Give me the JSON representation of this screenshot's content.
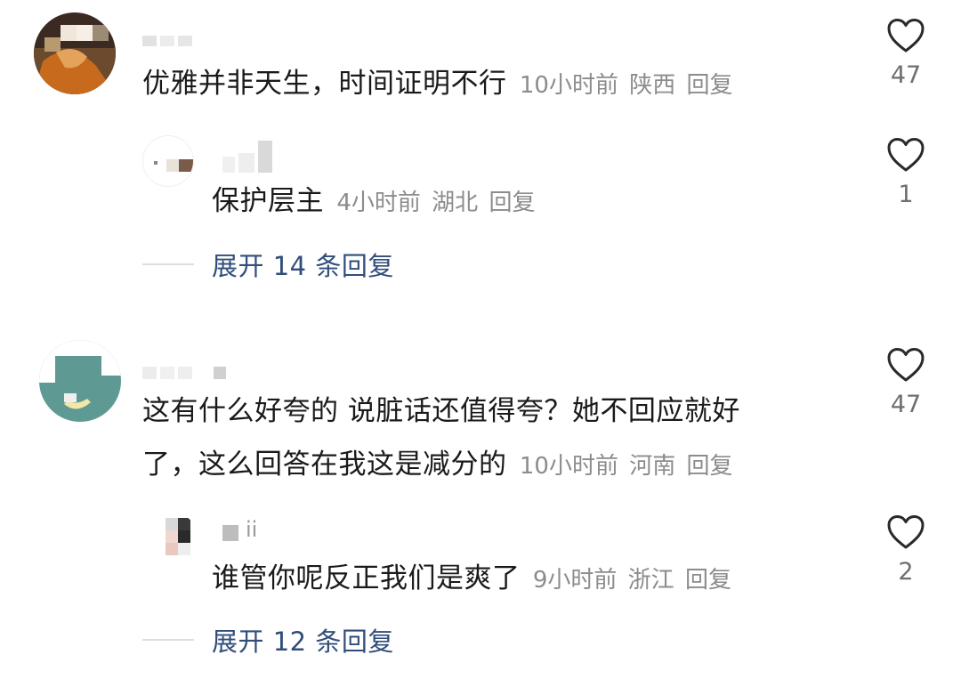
{
  "comments": [
    {
      "text_lines": [
        "优雅并非天生，时间证明不行"
      ],
      "time": "10小时前",
      "location": "陕西",
      "reply_label": "回复",
      "likes": "47",
      "reply": {
        "text": "保护层主",
        "time": "4小时前",
        "location": "湖北",
        "reply_label": "回复",
        "likes": "1",
        "name_suffix": ""
      },
      "expand_label": "展开 14 条回复"
    },
    {
      "text_lines": [
        "这有什么好夸的 说脏话还值得夸？她不回应就好",
        "了，这么回答在我这是减分的"
      ],
      "time": "10小时前",
      "location": "河南",
      "reply_label": "回复",
      "likes": "47",
      "reply": {
        "text": "谁管你呢反正我们是爽了",
        "time": "9小时前",
        "location": "浙江",
        "reply_label": "回复",
        "likes": "2",
        "name_suffix": "ii"
      },
      "expand_label": "展开 12 条回复"
    }
  ],
  "icons": {
    "like": "heart-outline-icon"
  },
  "colors": {
    "link": "#314d7a",
    "meta": "#8c8c8c",
    "text": "#1a1a1a"
  }
}
